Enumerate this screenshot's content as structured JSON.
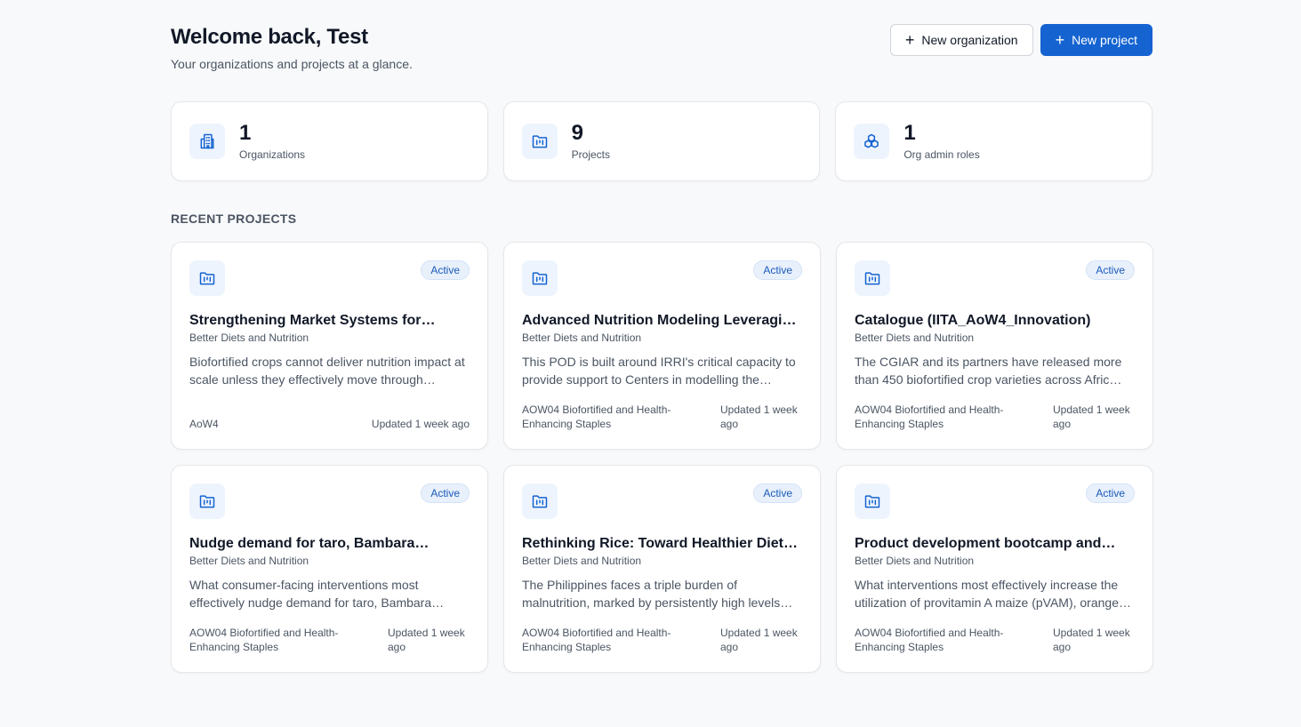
{
  "header": {
    "title": "Welcome back, Test",
    "subtitle": "Your organizations and projects at a glance.",
    "new_org_label": "New organization",
    "new_project_label": "New project"
  },
  "stats": [
    {
      "value": "1",
      "label": "Organizations",
      "icon": "building-icon"
    },
    {
      "value": "9",
      "label": "Projects",
      "icon": "folder-icon"
    },
    {
      "value": "1",
      "label": "Org admin roles",
      "icon": "blocks-icon"
    }
  ],
  "recent": {
    "title": "RECENT PROJECTS",
    "projects": [
      {
        "status": "Active",
        "title": "Strengthening Market Systems for…",
        "org": "Better Diets and Nutrition",
        "description": "Biofortified crops cannot deliver nutrition impact at scale unless they effectively move through…",
        "tag": "AoW4",
        "updated": "Updated 1 week ago"
      },
      {
        "status": "Active",
        "title": "Advanced Nutrition Modeling Leveragin…",
        "org": "Better Diets and Nutrition",
        "description": "This POD is built around IRRI's critical capacity to provide support to Centers in modelling the…",
        "tag": "AOW04 Biofortified and Health-Enhancing Staples",
        "updated": "Updated 1 week ago"
      },
      {
        "status": "Active",
        "title": "Catalogue (IITA_AoW4_Innovation)",
        "org": "Better Diets and Nutrition",
        "description": "The CGIAR and its partners have released more than 450 biofortified crop varieties across Afric…",
        "tag": "AOW04 Biofortified and Health-Enhancing Staples",
        "updated": "Updated 1 week ago"
      },
      {
        "status": "Active",
        "title": "Nudge demand for taro, Bambara…",
        "org": "Better Diets and Nutrition",
        "description": "What consumer-facing interventions most effectively nudge demand for taro, Bambara…",
        "tag": "AOW04 Biofortified and Health-Enhancing Staples",
        "updated": "Updated 1 week ago"
      },
      {
        "status": "Active",
        "title": "Rethinking Rice: Toward Healthier Diets…",
        "org": "Better Diets and Nutrition",
        "description": "The Philippines faces a triple burden of malnutrition, marked by persistently high levels…",
        "tag": "AOW04 Biofortified and Health-Enhancing Staples",
        "updated": "Updated 1 week ago"
      },
      {
        "status": "Active",
        "title": "Product development bootcamp and…",
        "org": "Better Diets and Nutrition",
        "description": "What interventions most effectively increase the utilization of provitamin A maize (pVAM), orange…",
        "tag": "AOW04 Biofortified and Health-Enhancing Staples",
        "updated": "Updated 1 week ago"
      }
    ]
  },
  "colors": {
    "accent": "#1463d1",
    "icon_bg": "#eef4fd",
    "badge_bg": "#e8f0fc"
  }
}
